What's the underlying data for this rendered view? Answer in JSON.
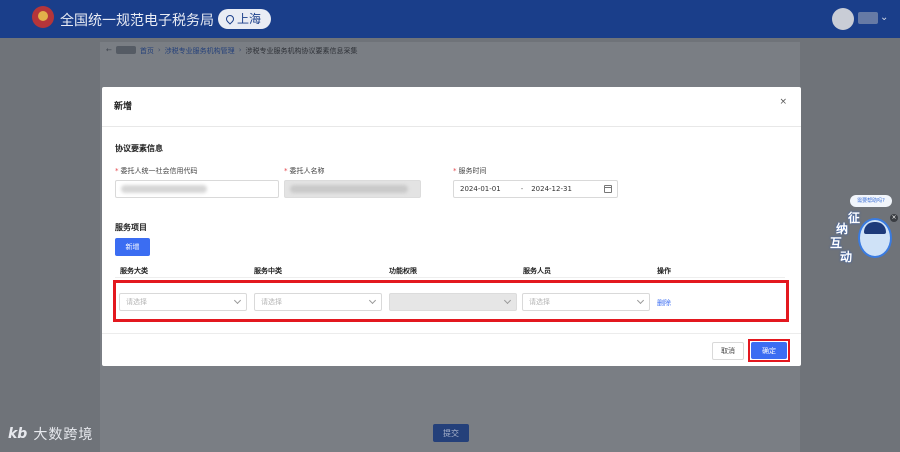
{
  "header": {
    "brand": "全国统一规范电子税务局",
    "region": "上海"
  },
  "breadcrumb": {
    "back": "←",
    "items": [
      "首页",
      "涉税专业服务机构管理",
      "涉税专业服务机构协议要素信息采集"
    ],
    "separator": "›"
  },
  "footer": {
    "submit_label": "提交"
  },
  "watermark": {
    "logo": "kb",
    "text": "大数跨境"
  },
  "widget": {
    "bubble": "需要帮助吗?",
    "close": "×",
    "chars": [
      "征",
      "纳",
      "互",
      "动"
    ]
  },
  "modal": {
    "title": "新增",
    "close": "×",
    "section_agreement": "协议要素信息",
    "fields": {
      "credit_code_label": "委托人统一社会信用代码",
      "client_name_label": "委托人名称",
      "service_time_label": "服务时间",
      "start_date": "2024-01-01",
      "date_separator": "-",
      "end_date": "2024-12-31"
    },
    "section_service": "服务项目",
    "add_label": "新增",
    "columns": [
      "服务大类",
      "服务中类",
      "功能权限",
      "服务人员",
      "操作"
    ],
    "row": {
      "category_placeholder": "请选择",
      "subcategory_placeholder": "请选择",
      "permission_placeholder": "",
      "staff_placeholder": "请选择",
      "delete_label": "删除"
    },
    "cancel_label": "取消",
    "confirm_label": "确定"
  },
  "colors": {
    "primary": "#3b6df2",
    "highlight": "#e3181f",
    "header_bg": "#1a3e8a"
  }
}
